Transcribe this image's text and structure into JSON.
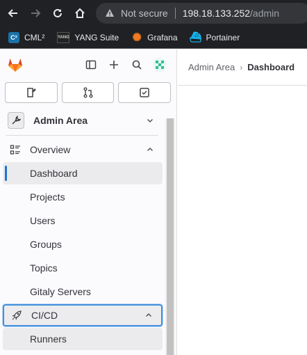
{
  "browser": {
    "not_secure": "Not secure",
    "url_host": "198.18.133.252",
    "url_path": "/admin",
    "bookmarks": [
      {
        "label": "CML²",
        "icon": "cml-icon"
      },
      {
        "label": "YANG Suite",
        "icon": "yang-suite-icon"
      },
      {
        "label": "Grafana",
        "icon": "grafana-icon"
      },
      {
        "label": "Portainer",
        "icon": "portainer-icon"
      }
    ]
  },
  "sidebar": {
    "admin_area": "Admin Area",
    "overview": "Overview",
    "overview_items": [
      "Dashboard",
      "Projects",
      "Users",
      "Groups",
      "Topics",
      "Gitaly Servers"
    ],
    "cicd": "CI/CD",
    "cicd_items": [
      "Runners"
    ]
  },
  "breadcrumb": {
    "parent": "Admin Area",
    "current": "Dashboard"
  },
  "colors": {
    "accent": "#1f75cb",
    "focus_ring": "#428fdc",
    "gitlab_orange": "#e24329"
  }
}
